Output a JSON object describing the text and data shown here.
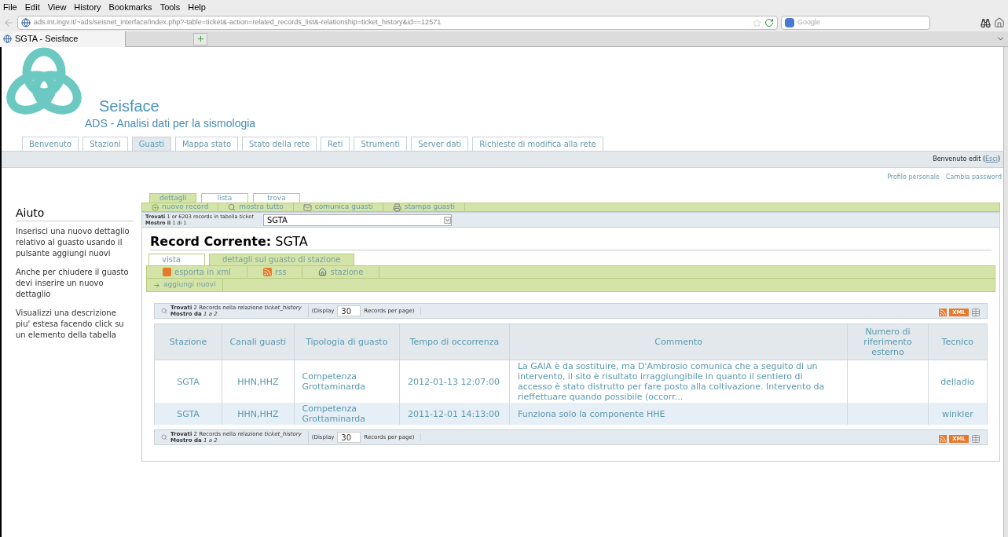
{
  "browser": {
    "menu": [
      "File",
      "Edit",
      "View",
      "History",
      "Bookmarks",
      "Tools",
      "Help"
    ],
    "url": "ads.int.ingv.it/~ads/seisnet_interface/index.php?-table=ticket&-action=related_records_list&-relationship=ticket_history&id==12571",
    "search_placeholder": "Google",
    "tabs": [
      {
        "title": "SGTA - Seisface",
        "selected": true
      }
    ]
  },
  "site": {
    "title": "Seisface",
    "subtitle": "ADS - Analisi dati per la sismologia",
    "nav": [
      {
        "label": "Benvenuto",
        "selected": false
      },
      {
        "label": "Stazioni",
        "selected": false
      },
      {
        "label": "Guasti",
        "selected": true
      },
      {
        "label": "Mappa stato",
        "selected": false
      },
      {
        "label": "Stato della rete",
        "selected": false
      },
      {
        "label": "Reti",
        "selected": false
      },
      {
        "label": "Strumenti",
        "selected": false
      },
      {
        "label": "Server dati",
        "selected": false
      },
      {
        "label": "Richieste di modifica alla rete",
        "selected": false
      }
    ],
    "greeting": "Benvenuto edit (",
    "logout": "Esci",
    "greeting_end": ")",
    "user_links": [
      "Profilo personale",
      "Cambia password"
    ]
  },
  "help": {
    "title": "Aiuto",
    "paragraphs": [
      "Inserisci una nuovo dettaglio relativo al guasto usando il pulsante aggiungi nuovi",
      "Anche per chiudere il guasto devi inserire un nuovo dettaglio",
      "Visualizzi una descrizione piu' estesa facendo click su un elemento della tabella"
    ]
  },
  "record_tabs": [
    {
      "label": "dettagli",
      "selected": true
    },
    {
      "label": "lista",
      "selected": false
    },
    {
      "label": "trova",
      "selected": false
    }
  ],
  "actions": [
    {
      "label": "nuovo record",
      "kind": "new"
    },
    {
      "label": "mostra tutto",
      "kind": "search"
    },
    {
      "label": "comunica guasti",
      "kind": "mail"
    },
    {
      "label": "stampa guasti",
      "kind": "print"
    }
  ],
  "found": {
    "text": "**Trovati** 1 or 6203 records in tabella *ticket*",
    "shown": "**Mostro il** 1 di 1",
    "select": "SGTA"
  },
  "record": {
    "label": "Record Corrente:",
    "value": "SGTA"
  },
  "sub_tabs": [
    {
      "label": "vista",
      "selected": false
    },
    {
      "label": "dettagli sul guasto di stazione",
      "selected": true
    }
  ],
  "sub_actions": [
    {
      "label": "esporta in xml",
      "kind": "xml"
    },
    {
      "label": "rss",
      "kind": "rss"
    },
    {
      "label": "stazione",
      "kind": "home"
    }
  ],
  "add_action": "aggiungi nuovi",
  "pagers": [
    {
      "found": "**Trovati** 2 Records nella relazione *ticket_history*",
      "shown": "**Mostro da** *1 a 2*",
      "display": "(Display",
      "per_page": "30",
      "per_page_end": "Records per page)",
      "xml": "XML"
    },
    {
      "found": "**Trovati** 2 Records nella relazione *ticket_history*",
      "shown": "**Mostro da** *1 a 2*",
      "display": "(Display",
      "per_page": "30",
      "per_page_end": "Records per page)",
      "xml": "XML"
    }
  ],
  "table": {
    "columns": [
      "Stazione",
      "Canali guasti",
      "Tipologia di guasto",
      "Tempo di occorrenza",
      "Commento",
      "Numero di riferimento esterno",
      "Tecnico"
    ],
    "rows": [
      {
        "selected": false,
        "cells": [
          "SGTA",
          "HHN,HHZ",
          "Competenza Grottaminarda",
          "2012-01-13 12:07:00",
          "La GAIA è da sostituire, ma D'Ambrosio comunica che a seguito di un intervento, il sito è risultato irraggiungibile in quanto il sentiero di accesso è stato distrutto per fare posto alla coltivazione. Intervento da rieffettuare quando possibile (occorr...",
          "",
          "delladio"
        ]
      },
      {
        "selected": true,
        "cells": [
          "SGTA",
          "HHN,HHZ",
          "Competenza Grottaminarda",
          "2011-12-01 14:13:00",
          "Funziona solo la componente HHE",
          "",
          "winkler"
        ]
      }
    ]
  }
}
